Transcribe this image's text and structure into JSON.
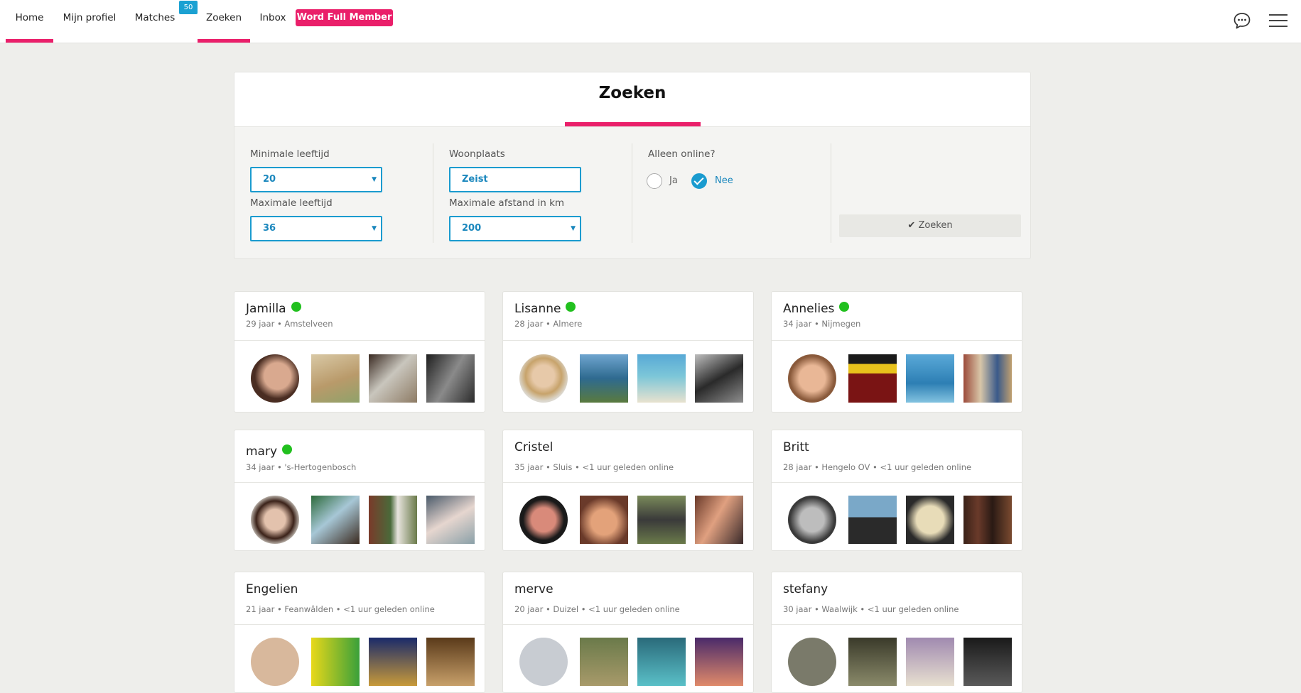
{
  "nav": {
    "items": [
      {
        "label": "Home",
        "active": true
      },
      {
        "label": "Mijn profiel",
        "active": false
      },
      {
        "label": "Matches",
        "active": false,
        "badge": "50"
      },
      {
        "label": "Zoeken",
        "active": true
      },
      {
        "label": "Inbox",
        "active": false
      }
    ],
    "cta_label": "Word Full Member",
    "icons": [
      "chat-icon",
      "menu-icon"
    ],
    "accent": "#ea1f6a",
    "badge_color": "#1ba1d2"
  },
  "search": {
    "title": "Zoeken",
    "min_age": {
      "label": "Minimale leeftijd",
      "value": "20"
    },
    "max_age": {
      "label": "Maximale leeftijd",
      "value": "36"
    },
    "city": {
      "label": "Woonplaats",
      "value": "Zeist"
    },
    "distance": {
      "label": "Maximale afstand in km",
      "value": "200"
    },
    "online": {
      "label": "Alleen online?",
      "options": [
        "Ja",
        "Nee"
      ],
      "selected": "Nee"
    },
    "submit_label": "Zoeken",
    "field_color": "#1a9bcf"
  },
  "profiles": [
    {
      "name": "Jamilla",
      "online": true,
      "meta": "29 jaar • Amstelveen"
    },
    {
      "name": "Lisanne",
      "online": true,
      "meta": "28 jaar • Almere"
    },
    {
      "name": "Annelies",
      "online": true,
      "meta": "34 jaar • Nijmegen"
    },
    {
      "name": "mary",
      "online": true,
      "meta": "34 jaar • 's-Hertogenbosch"
    },
    {
      "name": "Cristel",
      "online": false,
      "meta": "35 jaar • Sluis • <1 uur geleden online"
    },
    {
      "name": "Britt",
      "online": false,
      "meta": "28 jaar • Hengelo OV • <1 uur geleden online"
    },
    {
      "name": "Engelien",
      "online": false,
      "meta": "21 jaar • Feanwâlden • <1 uur geleden online"
    },
    {
      "name": "merve",
      "online": false,
      "meta": "20 jaar • Duizel • <1 uur geleden online"
    },
    {
      "name": "stefany",
      "online": false,
      "meta": "30 jaar • Waalwijk • <1 uur geleden online"
    }
  ],
  "online_color": "#21c01e"
}
